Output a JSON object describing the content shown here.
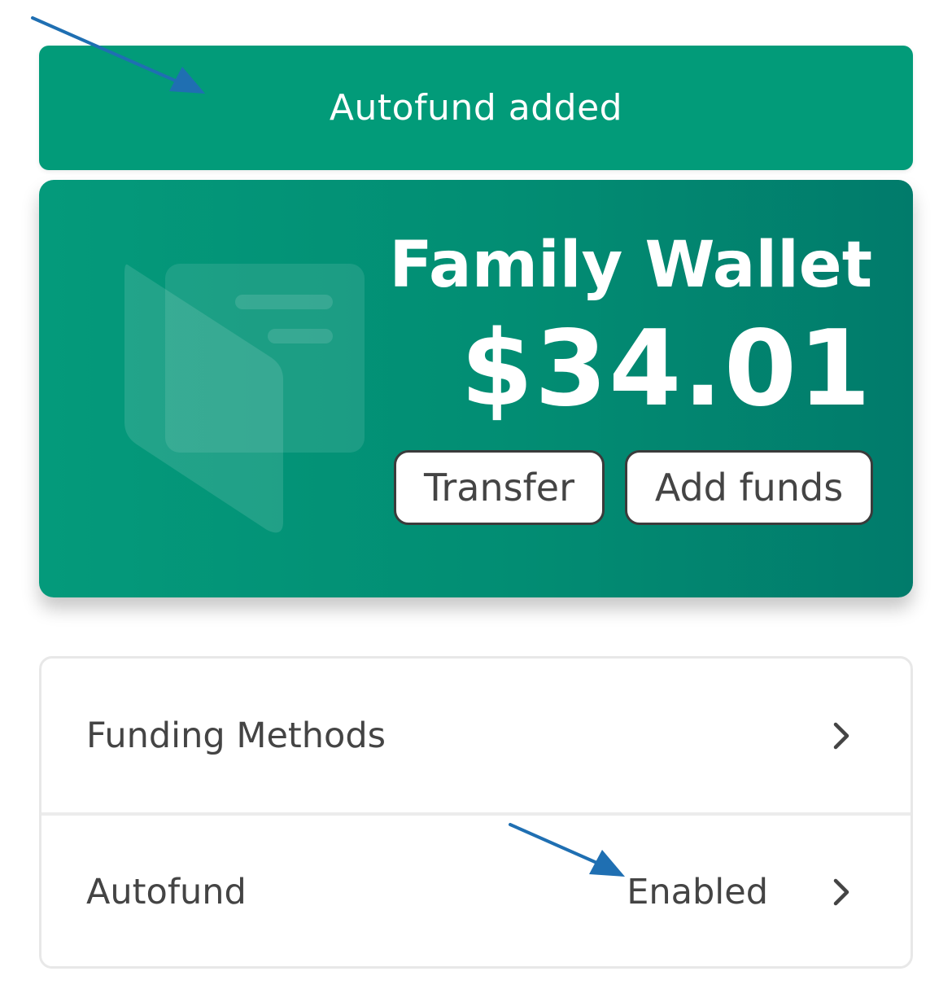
{
  "toast": {
    "message": "Autofund added",
    "color": "#029b79"
  },
  "wallet": {
    "name": "Family Wallet",
    "balance": "$34.01",
    "transfer_label": "Transfer",
    "add_funds_label": "Add funds",
    "icon": "wallet-icon"
  },
  "settings": {
    "items": [
      {
        "label": "Funding Methods",
        "value": "",
        "icon": "chevron-right-icon"
      },
      {
        "label": "Autofund",
        "value": "Enabled",
        "icon": "chevron-right-icon"
      }
    ]
  },
  "annotations": {
    "arrow_color": "#1f6fb2"
  }
}
